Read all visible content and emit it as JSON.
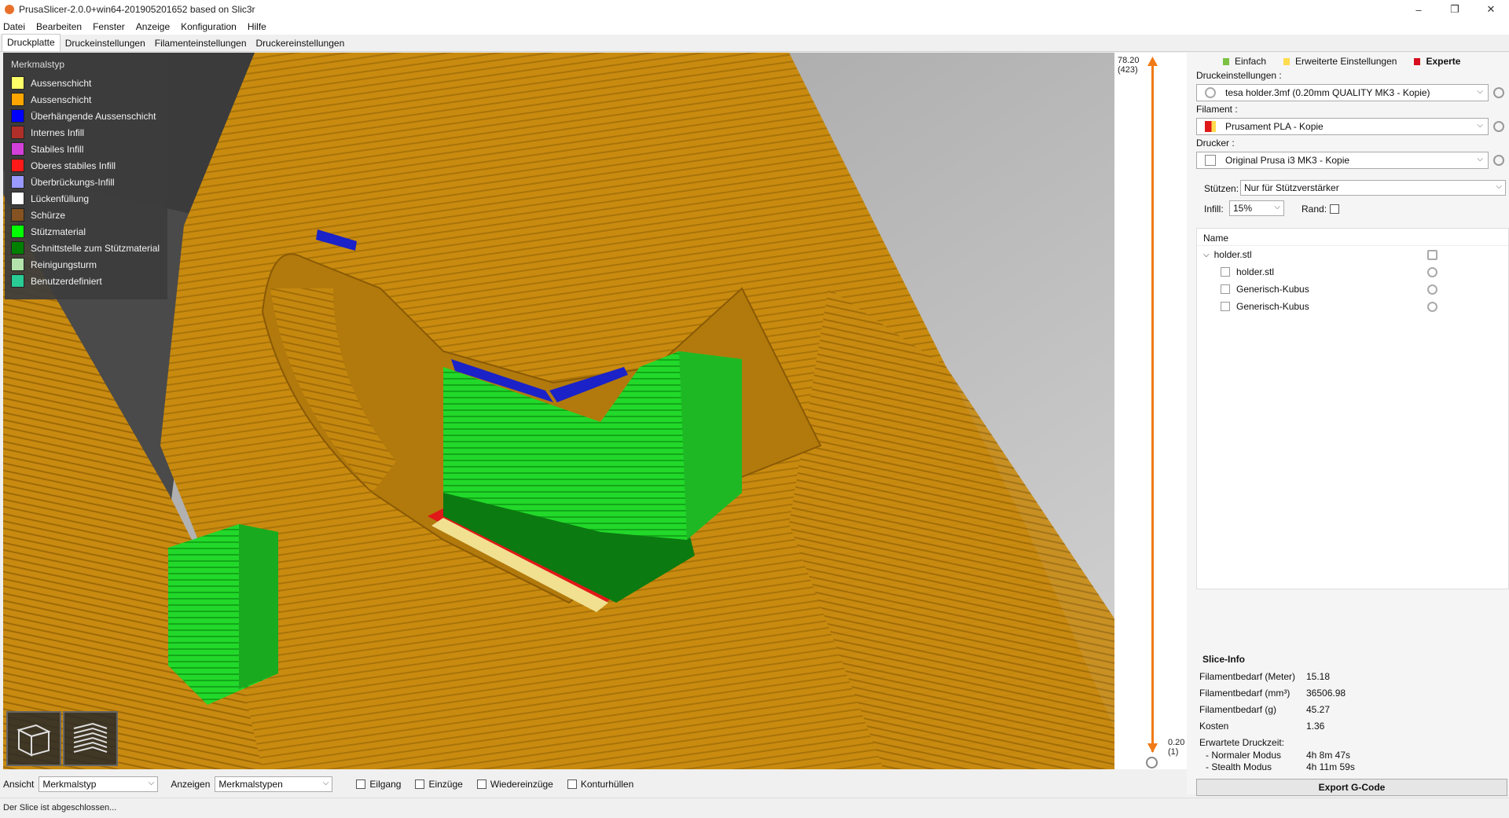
{
  "window": {
    "title": "PrusaSlicer-2.0.0+win64-201905201652 based on Slic3r",
    "controls": {
      "minimize": "–",
      "maximize": "❐",
      "close": "✕"
    }
  },
  "menu": [
    "Datei",
    "Bearbeiten",
    "Fenster",
    "Anzeige",
    "Konfiguration",
    "Hilfe"
  ],
  "tabs": [
    {
      "label": "Druckplatte",
      "active": true
    },
    {
      "label": "Druckeinstellungen",
      "active": false
    },
    {
      "label": "Filamenteinstellungen",
      "active": false
    },
    {
      "label": "Druckereinstellungen",
      "active": false
    }
  ],
  "legend": {
    "title": "Merkmalstyp",
    "items": [
      {
        "label": "Aussenschicht",
        "color": "#ffff68"
      },
      {
        "label": "Aussenschicht",
        "color": "#ffa500"
      },
      {
        "label": "Überhängende Aussenschicht",
        "color": "#0000ff"
      },
      {
        "label": "Internes Infill",
        "color": "#b03029"
      },
      {
        "label": "Stabiles Infill",
        "color": "#d33fd9"
      },
      {
        "label": "Oberes stabiles Infill",
        "color": "#ff1a1a"
      },
      {
        "label": "Überbrückungs-Infill",
        "color": "#9999ff"
      },
      {
        "label": "Lückenfüllung",
        "color": "#ffffff"
      },
      {
        "label": "Schürze",
        "color": "#845321"
      },
      {
        "label": "Stützmaterial",
        "color": "#00ff00"
      },
      {
        "label": "Schnittstelle zum Stützmaterial",
        "color": "#008000"
      },
      {
        "label": "Reinigungsturm",
        "color": "#b3e3ab"
      },
      {
        "label": "Benutzerdefiniert",
        "color": "#28cc94"
      }
    ]
  },
  "layer_slider": {
    "top_value": "78.20",
    "top_layer": "(423)",
    "bottom_value": "0.20",
    "bottom_layer": "(1)"
  },
  "modes": [
    {
      "label": "Einfach",
      "color": "#7bc142"
    },
    {
      "label": "Erweiterte Einstellungen",
      "color": "#ffdc4e"
    },
    {
      "label": "Experte",
      "color": "#d60e1d"
    }
  ],
  "presets": {
    "print_label": "Druckeinstellungen :",
    "print_value": "tesa holder.3mf (0.20mm QUALITY MK3 - Kopie)",
    "filament_label": "Filament :",
    "filament_value": "Prusament PLA - Kopie",
    "printer_label": "Drucker :",
    "printer_value": "Original Prusa i3 MK3 - Kopie",
    "supports_label": "Stützen:",
    "supports_value": "Nur für Stützverstärker",
    "infill_label": "Infill:",
    "infill_value": "15%",
    "brim_label": "Rand:"
  },
  "objects": {
    "header": "Name",
    "rows": [
      {
        "label": "holder.stl",
        "level": 0
      },
      {
        "label": "holder.stl",
        "level": 1
      },
      {
        "label": "Generisch-Kubus",
        "level": 1
      },
      {
        "label": "Generisch-Kubus",
        "level": 1
      }
    ]
  },
  "slice_info": {
    "title": "Slice-Info",
    "rows": [
      {
        "key": "Filamentbedarf (Meter)",
        "value": "15.18"
      },
      {
        "key": "Filamentbedarf (mm³)",
        "value": "36506.98"
      },
      {
        "key": "Filamentbedarf (g)",
        "value": "45.27"
      },
      {
        "key": "Kosten",
        "value": "1.36"
      }
    ],
    "estimated_title": "Erwartete Druckzeit:",
    "normal_key": "- Normaler Modus",
    "normal_value": "4h 8m 47s",
    "stealth_key": "- Stealth Modus",
    "stealth_value": "4h 11m 59s"
  },
  "export_button": "Export G-Code",
  "bottom_bar": {
    "view_label": "Ansicht",
    "view_value": "Merkmalstyp",
    "show_label": "Anzeigen",
    "show_value": "Merkmalstypen",
    "checkboxes": [
      "Eilgang",
      "Einzüge",
      "Wiedereinzüge",
      "Konturhüllen"
    ]
  },
  "status": "Der Slice ist abgeschlossen..."
}
